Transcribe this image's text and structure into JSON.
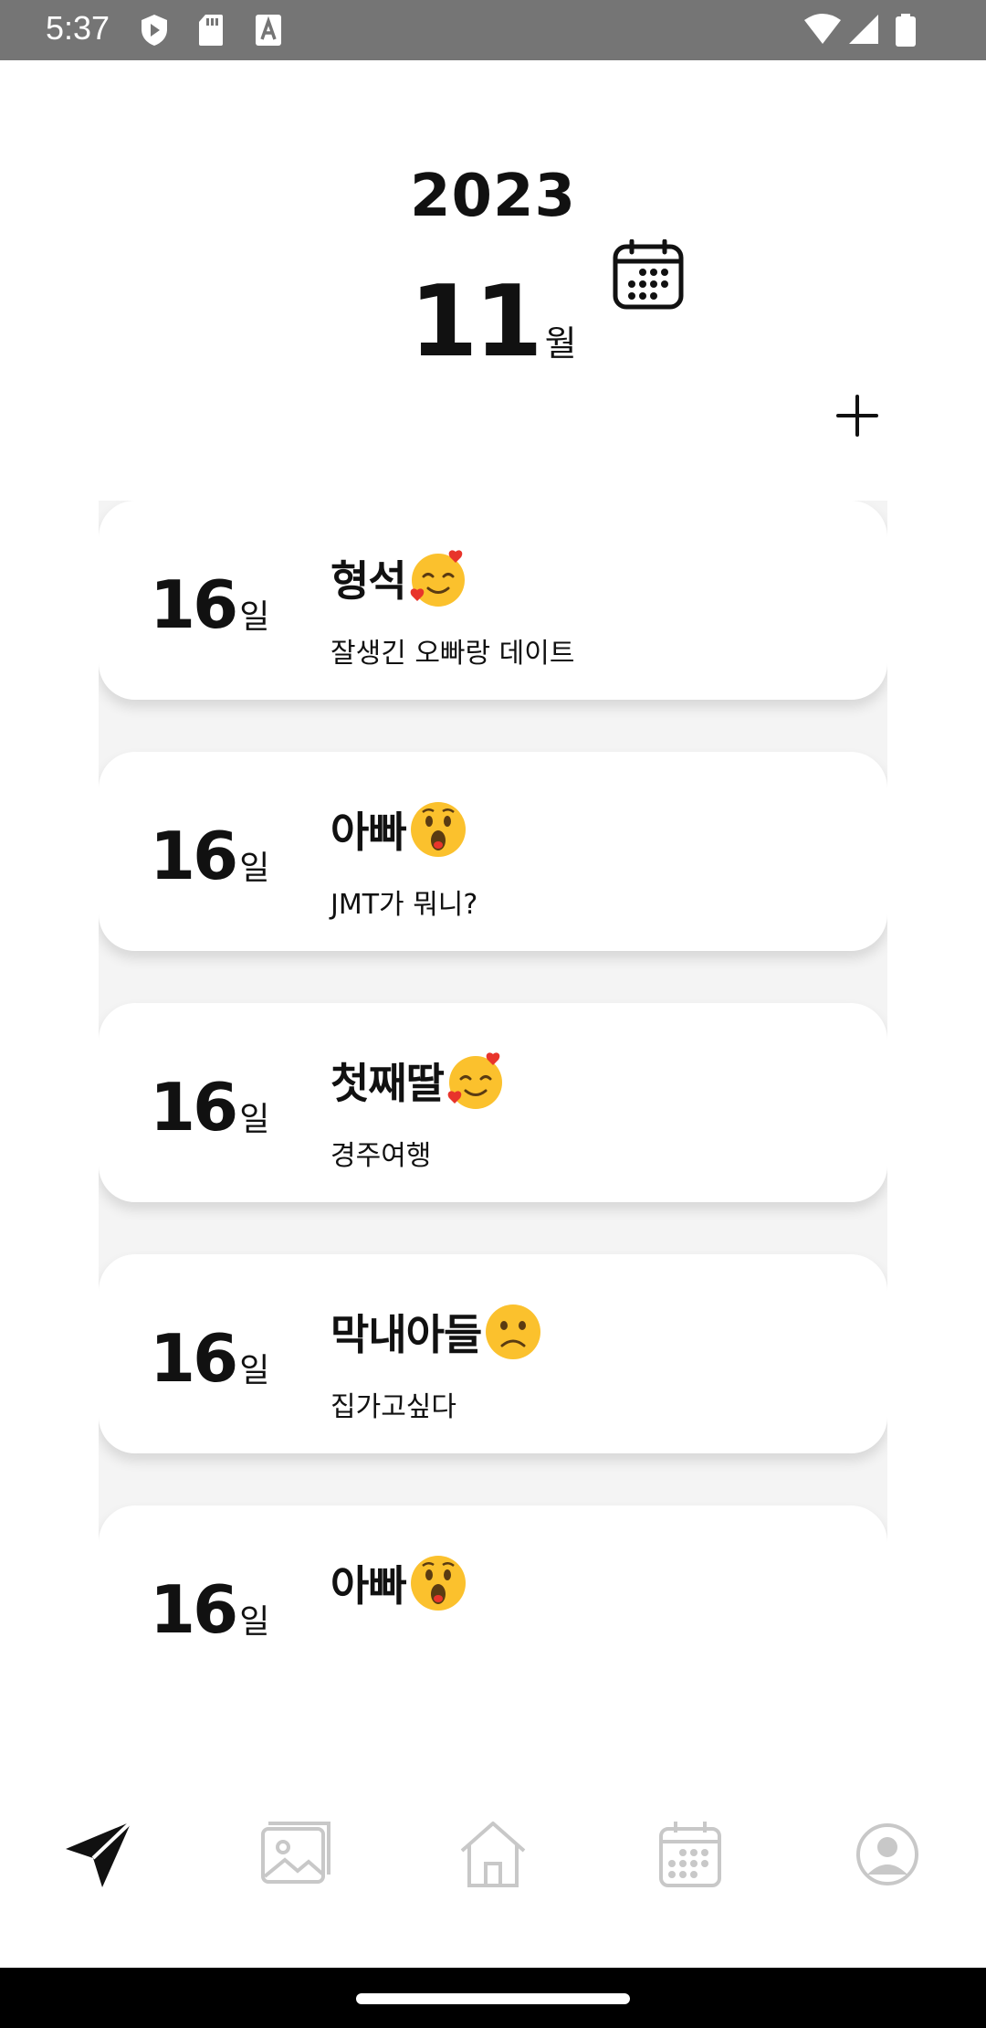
{
  "status_bar": {
    "time": "5:37"
  },
  "header": {
    "year": "2023",
    "month": "11",
    "month_suffix": "월"
  },
  "day_suffix": "일",
  "entries": [
    {
      "day": "16",
      "title": "형석",
      "emoji": "smiling-face-with-hearts",
      "memo": "잘생긴 오빠랑 데이트"
    },
    {
      "day": "16",
      "title": "아빠",
      "emoji": "astonished-face",
      "memo": "JMT가 뭐니?"
    },
    {
      "day": "16",
      "title": "첫째딸",
      "emoji": "smiling-face-with-hearts",
      "memo": "경주여행"
    },
    {
      "day": "16",
      "title": "막내아들",
      "emoji": "frowning-face",
      "memo": "집가고싶다"
    },
    {
      "day": "16",
      "title": "아빠",
      "emoji": "astonished-face",
      "memo": ""
    }
  ],
  "bottom_nav": [
    "send-icon",
    "gallery-icon",
    "home-icon",
    "calendar-icon",
    "profile-icon"
  ],
  "colors": {
    "status_bar": "#757575",
    "emoji_yellow": "#FBC12D",
    "heart_red": "#E8342B",
    "nav_inactive": "#c8c8c8"
  }
}
